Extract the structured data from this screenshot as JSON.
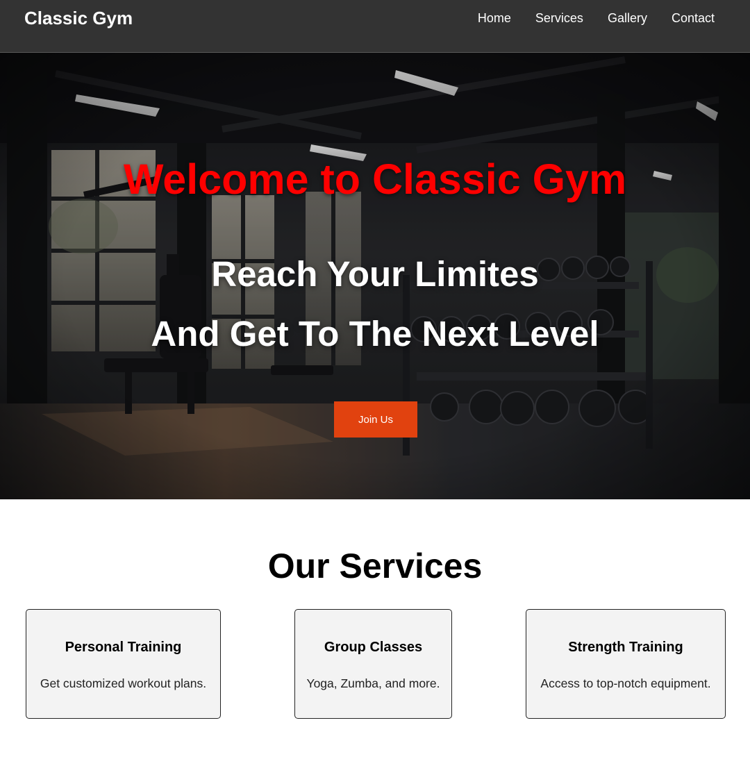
{
  "header": {
    "brand": "Classic Gym",
    "nav": [
      "Home",
      "Services",
      "Gallery",
      "Contact"
    ]
  },
  "hero": {
    "title": "Welcome to Classic Gym",
    "line1": "Reach Your Limites",
    "line2": "And Get To The Next Level",
    "cta": "Join Us"
  },
  "services": {
    "title": "Our Services",
    "cards": [
      {
        "title": "Personal Training",
        "description": "Get customized workout plans."
      },
      {
        "title": "Group Classes",
        "description": "Yoga, Zumba, and more."
      },
      {
        "title": "Strength Training",
        "description": "Access to top-notch equipment."
      }
    ]
  },
  "colors": {
    "header_bg": "#333333",
    "hero_title": "#ff0000",
    "cta_bg": "#e1420f",
    "card_bg": "#f3f3f3"
  }
}
